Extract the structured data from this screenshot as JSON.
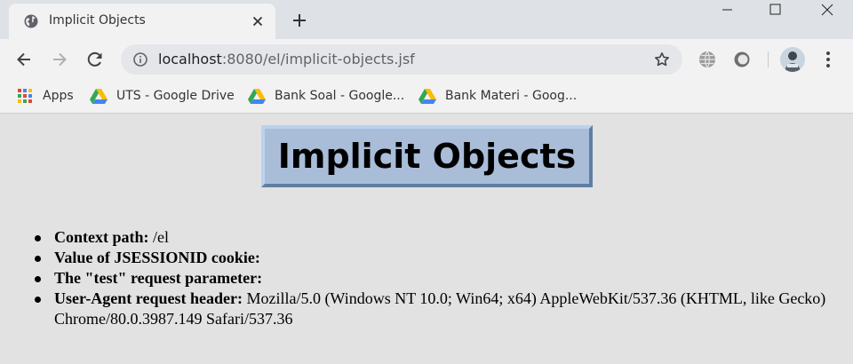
{
  "browser": {
    "tab": {
      "title": "Implicit Objects"
    },
    "address_bar": {
      "host": "localhost",
      "path": ":8080/el/implicit-objects.jsf"
    },
    "bookmarks": [
      {
        "label": "Apps",
        "icon": "apps-grid-icon"
      },
      {
        "label": "UTS - Google Drive",
        "icon": "google-drive-icon"
      },
      {
        "label": "Bank Soal - Google...",
        "icon": "google-drive-icon"
      },
      {
        "label": "Bank Materi - Goog...",
        "icon": "google-drive-icon"
      }
    ]
  },
  "page": {
    "heading": "Implicit Objects",
    "items": [
      {
        "label": "Context path:",
        "value": " /el"
      },
      {
        "label": "Value of JSESSIONID cookie:",
        "value": ""
      },
      {
        "label": "The \"test\" request parameter:",
        "value": ""
      },
      {
        "label": "User-Agent request header:",
        "value": " Mozilla/5.0 (Windows NT 10.0; Win64; x64) AppleWebKit/537.36 (KHTML, like Gecko) Chrome/80.0.3987.149 Safari/537.36"
      }
    ]
  },
  "colors": {
    "heading_bg": "#a9bdd8",
    "page_bg": "#e2e2e2",
    "toolbar_bg": "#f2f2f2",
    "tabstrip_bg": "#dee1e6"
  }
}
